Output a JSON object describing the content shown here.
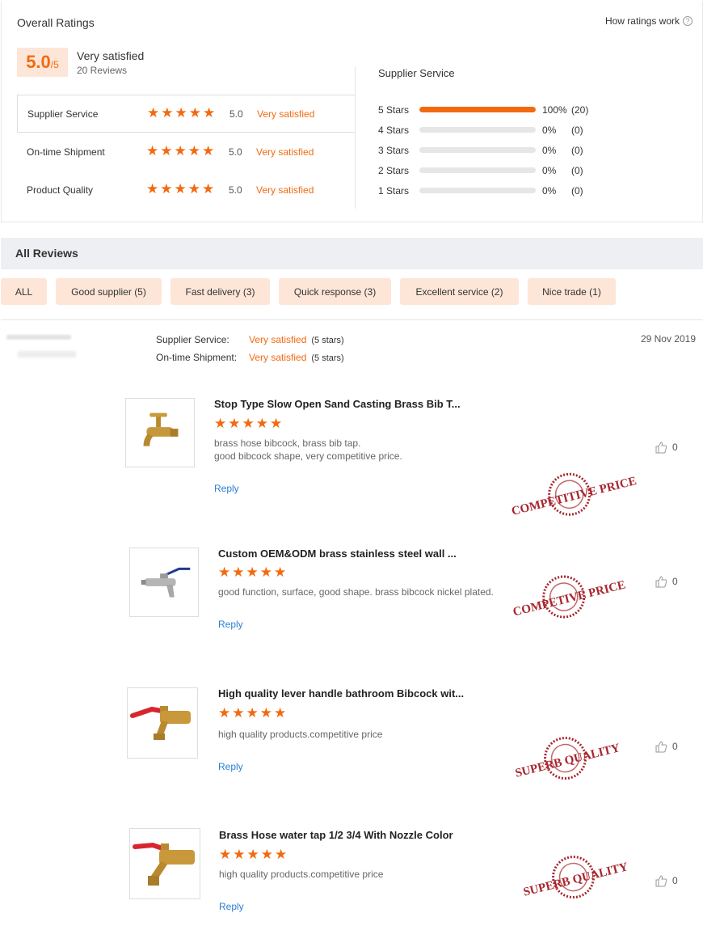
{
  "overall": {
    "title": "Overall Ratings",
    "how_link": "How ratings work",
    "score": "5.0",
    "score_max": "/5",
    "satisfaction": "Very satisfied",
    "reviews": "20 Reviews"
  },
  "categories": [
    {
      "name": "Supplier Service",
      "score": "5.0",
      "label": "Very satisfied"
    },
    {
      "name": "On-time Shipment",
      "score": "5.0",
      "label": "Very satisfied"
    },
    {
      "name": "Product Quality",
      "score": "5.0",
      "label": "Very satisfied"
    }
  ],
  "distribution": {
    "title": "Supplier Service",
    "rows": [
      {
        "label": "5 Stars",
        "fraction": 1.0,
        "pct": "100%",
        "count": "(20)"
      },
      {
        "label": "4 Stars",
        "fraction": 0,
        "pct": "0%",
        "count": "(0)"
      },
      {
        "label": "3 Stars",
        "fraction": 0,
        "pct": "0%",
        "count": "(0)"
      },
      {
        "label": "2 Stars",
        "fraction": 0,
        "pct": "0%",
        "count": "(0)"
      },
      {
        "label": "1 Stars",
        "fraction": 0,
        "pct": "0%",
        "count": "(0)"
      }
    ]
  },
  "all_reviews": {
    "title": "All Reviews",
    "tags": [
      "ALL",
      "Good supplier (5)",
      "Fast delivery (3)",
      "Quick response (3)",
      "Excellent service (2)",
      "Nice trade (1)"
    ]
  },
  "review": {
    "date": "29 Nov 2019",
    "meta": [
      {
        "label": "Supplier Service:",
        "value": "Very satisfied",
        "stars": "(5 stars)"
      },
      {
        "label": "On-time Shipment:",
        "value": "Very satisfied",
        "stars": "(5 stars)"
      }
    ],
    "items": [
      {
        "title": "Stop Type Slow Open Sand Casting Brass Bib T...",
        "text": [
          "brass hose bibcock, brass bib tap.",
          "good bibcock shape, very competitive price."
        ],
        "reply": "Reply",
        "likes": "0",
        "stamp": "COMPETITIVE PRICE"
      },
      {
        "title": "Custom OEM&ODM brass stainless steel wall ...",
        "text": [
          "good function, surface, good shape. brass bibcock nickel plated."
        ],
        "reply": "Reply",
        "likes": "0",
        "stamp": "COMPETIVE PRICE"
      },
      {
        "title": "High quality lever handle bathroom Bibcock wit...",
        "text": [
          "high quality products.competitive price"
        ],
        "reply": "Reply",
        "likes": "0",
        "stamp": "SUPERB QUALITY"
      },
      {
        "title": "Brass Hose water tap 1/2 3/4 With Nozzle Color",
        "text": [
          "high quality products.competitive price"
        ],
        "reply": "Reply",
        "likes": "0",
        "stamp": "SUPERB QUALITY"
      }
    ]
  },
  "colors": {
    "accent": "#f26a10",
    "tag_bg": "#fde6d8",
    "link": "#2a7fd4",
    "stamp": "#a8262e"
  }
}
